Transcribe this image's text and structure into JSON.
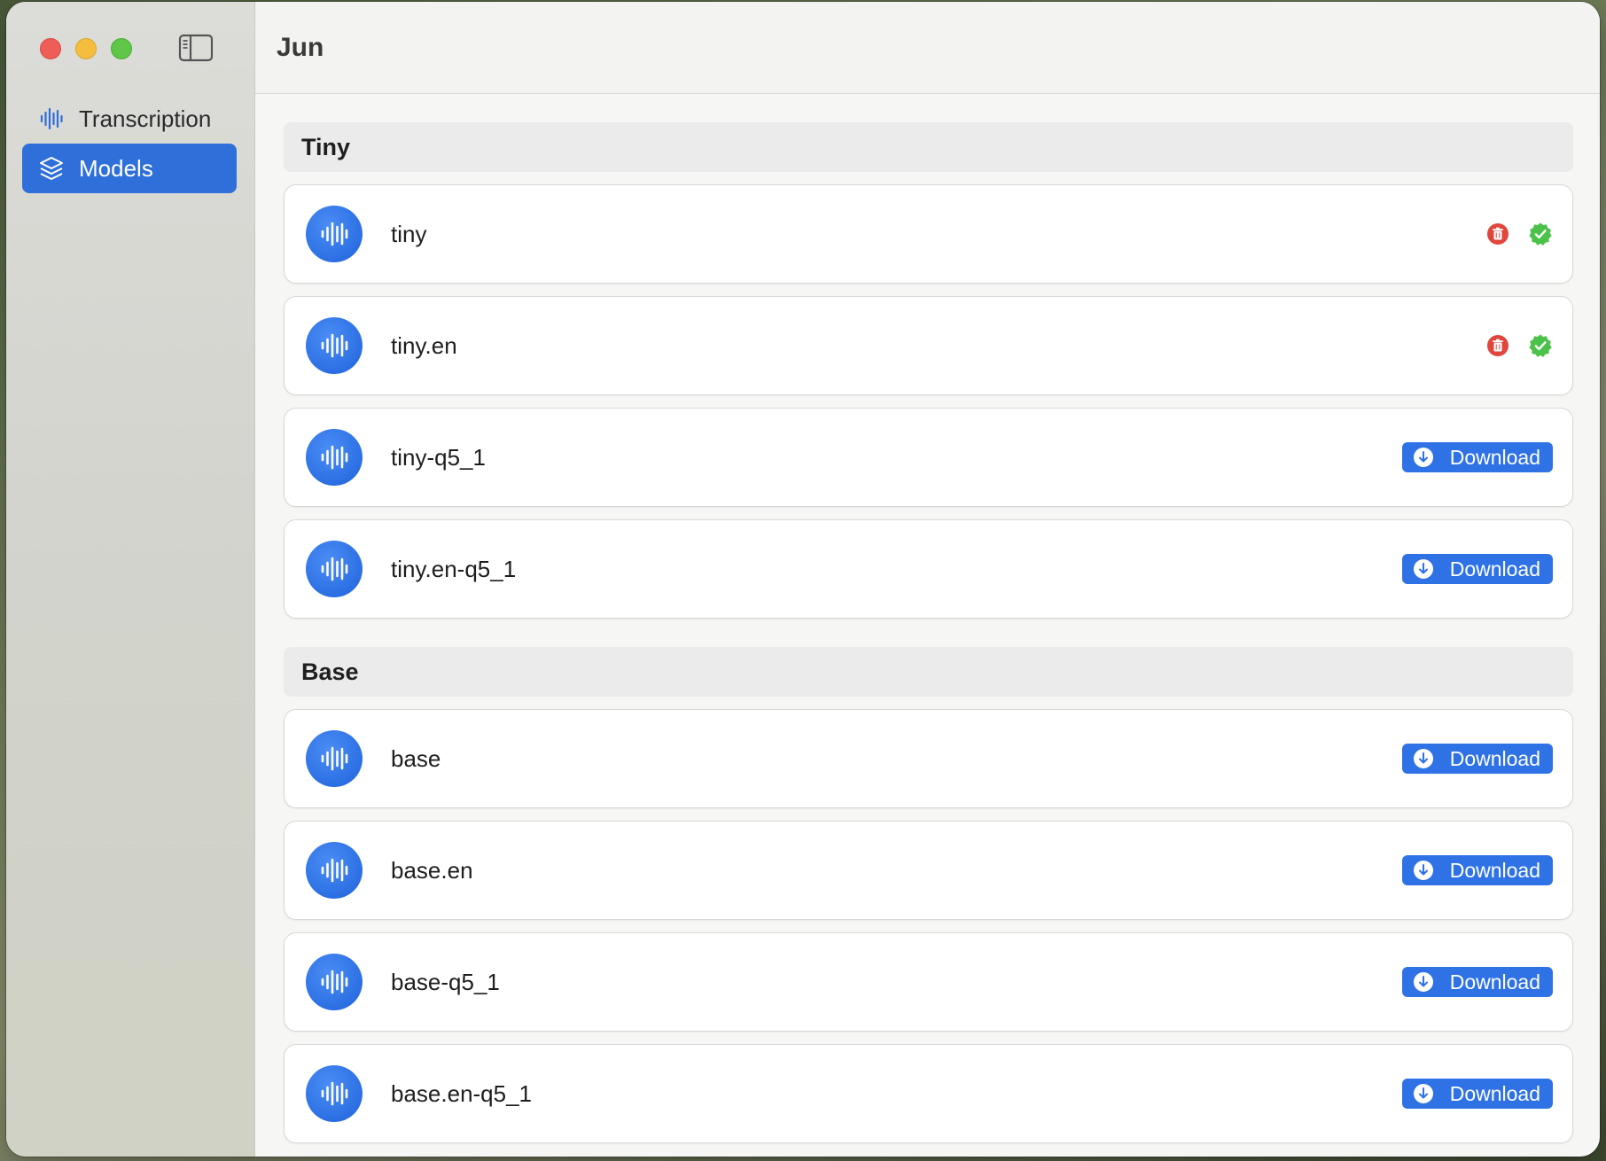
{
  "window": {
    "title": "Jun"
  },
  "sidebar": {
    "items": [
      {
        "label": "Transcription",
        "icon": "waveform-icon",
        "active": false
      },
      {
        "label": "Models",
        "icon": "layers-icon",
        "active": true
      }
    ]
  },
  "sections": [
    {
      "title": "Tiny",
      "models": [
        {
          "name": "tiny",
          "downloaded": true
        },
        {
          "name": "tiny.en",
          "downloaded": true
        },
        {
          "name": "tiny-q5_1",
          "downloaded": false
        },
        {
          "name": "tiny.en-q5_1",
          "downloaded": false
        }
      ]
    },
    {
      "title": "Base",
      "models": [
        {
          "name": "base",
          "downloaded": false
        },
        {
          "name": "base.en",
          "downloaded": false
        },
        {
          "name": "base-q5_1",
          "downloaded": false
        },
        {
          "name": "base.en-q5_1",
          "downloaded": false
        }
      ]
    }
  ],
  "labels": {
    "download": "Download"
  },
  "colors": {
    "accent": "#2f6fd9",
    "delete": "#e0463c",
    "installed": "#4cc24a"
  }
}
